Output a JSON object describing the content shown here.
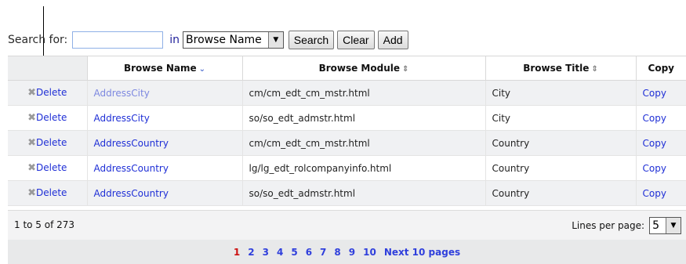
{
  "search": {
    "label": "Search for:",
    "value": "",
    "in_label": "in",
    "field": "Browse Name",
    "buttons": {
      "search": "Search",
      "clear": "Clear",
      "add": "Add"
    }
  },
  "columns": {
    "name": "Browse Name",
    "module": "Browse Module",
    "title": "Browse Title",
    "copy": "Copy"
  },
  "rows": [
    {
      "delete": "Delete",
      "name": "AddressCity",
      "module": "cm/cm_edt_cm_mstr.html",
      "title": "City",
      "copy": "Copy"
    },
    {
      "delete": "Delete",
      "name": "AddressCity",
      "module": "so/so_edt_admstr.html",
      "title": "City",
      "copy": "Copy"
    },
    {
      "delete": "Delete",
      "name": "AddressCountry",
      "module": "cm/cm_edt_cm_mstr.html",
      "title": "Country",
      "copy": "Copy"
    },
    {
      "delete": "Delete",
      "name": "AddressCountry",
      "module": "lg/lg_edt_rolcompanyinfo.html",
      "title": "Country",
      "copy": "Copy"
    },
    {
      "delete": "Delete",
      "name": "AddressCountry",
      "module": "so/so_edt_admstr.html",
      "title": "Country",
      "copy": "Copy"
    }
  ],
  "footer": {
    "count": "1 to 5 of 273",
    "lines_label": "Lines per page:",
    "lines_value": "5"
  },
  "pager": {
    "pages": [
      "1",
      "2",
      "3",
      "4",
      "5",
      "6",
      "7",
      "8",
      "9",
      "10"
    ],
    "current": "1",
    "next": "Next 10 pages"
  },
  "icons": {
    "sort_active": "chevron-down-icon",
    "sort_inactive": "sort-updown-icon",
    "delete": "x-icon",
    "dropdown": "dropdown-arrow-icon"
  },
  "colors": {
    "link": "#1f2fd6",
    "visited_link": "#7d88e0",
    "current_page": "#cc1111"
  }
}
